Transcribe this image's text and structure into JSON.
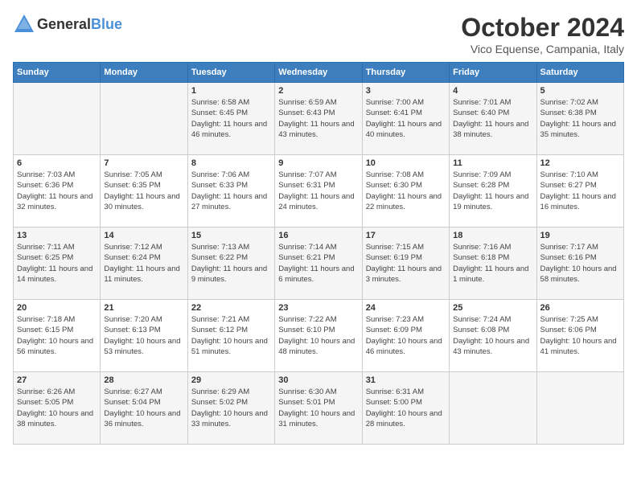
{
  "header": {
    "logo_general": "General",
    "logo_blue": "Blue",
    "month_title": "October 2024",
    "location": "Vico Equense, Campania, Italy"
  },
  "calendar": {
    "days_of_week": [
      "Sunday",
      "Monday",
      "Tuesday",
      "Wednesday",
      "Thursday",
      "Friday",
      "Saturday"
    ],
    "weeks": [
      [
        {
          "day": "",
          "info": ""
        },
        {
          "day": "",
          "info": ""
        },
        {
          "day": "1",
          "info": "Sunrise: 6:58 AM\nSunset: 6:45 PM\nDaylight: 11 hours and 46 minutes."
        },
        {
          "day": "2",
          "info": "Sunrise: 6:59 AM\nSunset: 6:43 PM\nDaylight: 11 hours and 43 minutes."
        },
        {
          "day": "3",
          "info": "Sunrise: 7:00 AM\nSunset: 6:41 PM\nDaylight: 11 hours and 40 minutes."
        },
        {
          "day": "4",
          "info": "Sunrise: 7:01 AM\nSunset: 6:40 PM\nDaylight: 11 hours and 38 minutes."
        },
        {
          "day": "5",
          "info": "Sunrise: 7:02 AM\nSunset: 6:38 PM\nDaylight: 11 hours and 35 minutes."
        }
      ],
      [
        {
          "day": "6",
          "info": "Sunrise: 7:03 AM\nSunset: 6:36 PM\nDaylight: 11 hours and 32 minutes."
        },
        {
          "day": "7",
          "info": "Sunrise: 7:05 AM\nSunset: 6:35 PM\nDaylight: 11 hours and 30 minutes."
        },
        {
          "day": "8",
          "info": "Sunrise: 7:06 AM\nSunset: 6:33 PM\nDaylight: 11 hours and 27 minutes."
        },
        {
          "day": "9",
          "info": "Sunrise: 7:07 AM\nSunset: 6:31 PM\nDaylight: 11 hours and 24 minutes."
        },
        {
          "day": "10",
          "info": "Sunrise: 7:08 AM\nSunset: 6:30 PM\nDaylight: 11 hours and 22 minutes."
        },
        {
          "day": "11",
          "info": "Sunrise: 7:09 AM\nSunset: 6:28 PM\nDaylight: 11 hours and 19 minutes."
        },
        {
          "day": "12",
          "info": "Sunrise: 7:10 AM\nSunset: 6:27 PM\nDaylight: 11 hours and 16 minutes."
        }
      ],
      [
        {
          "day": "13",
          "info": "Sunrise: 7:11 AM\nSunset: 6:25 PM\nDaylight: 11 hours and 14 minutes."
        },
        {
          "day": "14",
          "info": "Sunrise: 7:12 AM\nSunset: 6:24 PM\nDaylight: 11 hours and 11 minutes."
        },
        {
          "day": "15",
          "info": "Sunrise: 7:13 AM\nSunset: 6:22 PM\nDaylight: 11 hours and 9 minutes."
        },
        {
          "day": "16",
          "info": "Sunrise: 7:14 AM\nSunset: 6:21 PM\nDaylight: 11 hours and 6 minutes."
        },
        {
          "day": "17",
          "info": "Sunrise: 7:15 AM\nSunset: 6:19 PM\nDaylight: 11 hours and 3 minutes."
        },
        {
          "day": "18",
          "info": "Sunrise: 7:16 AM\nSunset: 6:18 PM\nDaylight: 11 hours and 1 minute."
        },
        {
          "day": "19",
          "info": "Sunrise: 7:17 AM\nSunset: 6:16 PM\nDaylight: 10 hours and 58 minutes."
        }
      ],
      [
        {
          "day": "20",
          "info": "Sunrise: 7:18 AM\nSunset: 6:15 PM\nDaylight: 10 hours and 56 minutes."
        },
        {
          "day": "21",
          "info": "Sunrise: 7:20 AM\nSunset: 6:13 PM\nDaylight: 10 hours and 53 minutes."
        },
        {
          "day": "22",
          "info": "Sunrise: 7:21 AM\nSunset: 6:12 PM\nDaylight: 10 hours and 51 minutes."
        },
        {
          "day": "23",
          "info": "Sunrise: 7:22 AM\nSunset: 6:10 PM\nDaylight: 10 hours and 48 minutes."
        },
        {
          "day": "24",
          "info": "Sunrise: 7:23 AM\nSunset: 6:09 PM\nDaylight: 10 hours and 46 minutes."
        },
        {
          "day": "25",
          "info": "Sunrise: 7:24 AM\nSunset: 6:08 PM\nDaylight: 10 hours and 43 minutes."
        },
        {
          "day": "26",
          "info": "Sunrise: 7:25 AM\nSunset: 6:06 PM\nDaylight: 10 hours and 41 minutes."
        }
      ],
      [
        {
          "day": "27",
          "info": "Sunrise: 6:26 AM\nSunset: 5:05 PM\nDaylight: 10 hours and 38 minutes."
        },
        {
          "day": "28",
          "info": "Sunrise: 6:27 AM\nSunset: 5:04 PM\nDaylight: 10 hours and 36 minutes."
        },
        {
          "day": "29",
          "info": "Sunrise: 6:29 AM\nSunset: 5:02 PM\nDaylight: 10 hours and 33 minutes."
        },
        {
          "day": "30",
          "info": "Sunrise: 6:30 AM\nSunset: 5:01 PM\nDaylight: 10 hours and 31 minutes."
        },
        {
          "day": "31",
          "info": "Sunrise: 6:31 AM\nSunset: 5:00 PM\nDaylight: 10 hours and 28 minutes."
        },
        {
          "day": "",
          "info": ""
        },
        {
          "day": "",
          "info": ""
        }
      ]
    ]
  }
}
